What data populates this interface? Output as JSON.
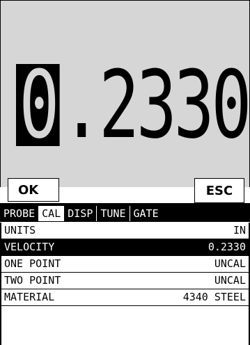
{
  "display": {
    "selected_digit": "0",
    "rest_value": ".2330"
  },
  "buttons": {
    "ok_label": "OK",
    "esc_label": "ESC"
  },
  "tabs": [
    {
      "label": "PROBE"
    },
    {
      "label": "CAL"
    },
    {
      "label": "DISP"
    },
    {
      "label": "TUNE"
    },
    {
      "label": "GATE"
    }
  ],
  "menu_rows": [
    {
      "label": "UNITS",
      "value": "IN"
    },
    {
      "label": "VELOCITY",
      "value": "0.2330"
    },
    {
      "label": "ONE POINT",
      "value": "UNCAL"
    },
    {
      "label": "TWO POINT",
      "value": "UNCAL"
    },
    {
      "label": "MATERIAL",
      "value": "4340 STEEL"
    }
  ],
  "colors": {
    "panel_bg": "#d6d6d6",
    "highlight": "#000000"
  }
}
